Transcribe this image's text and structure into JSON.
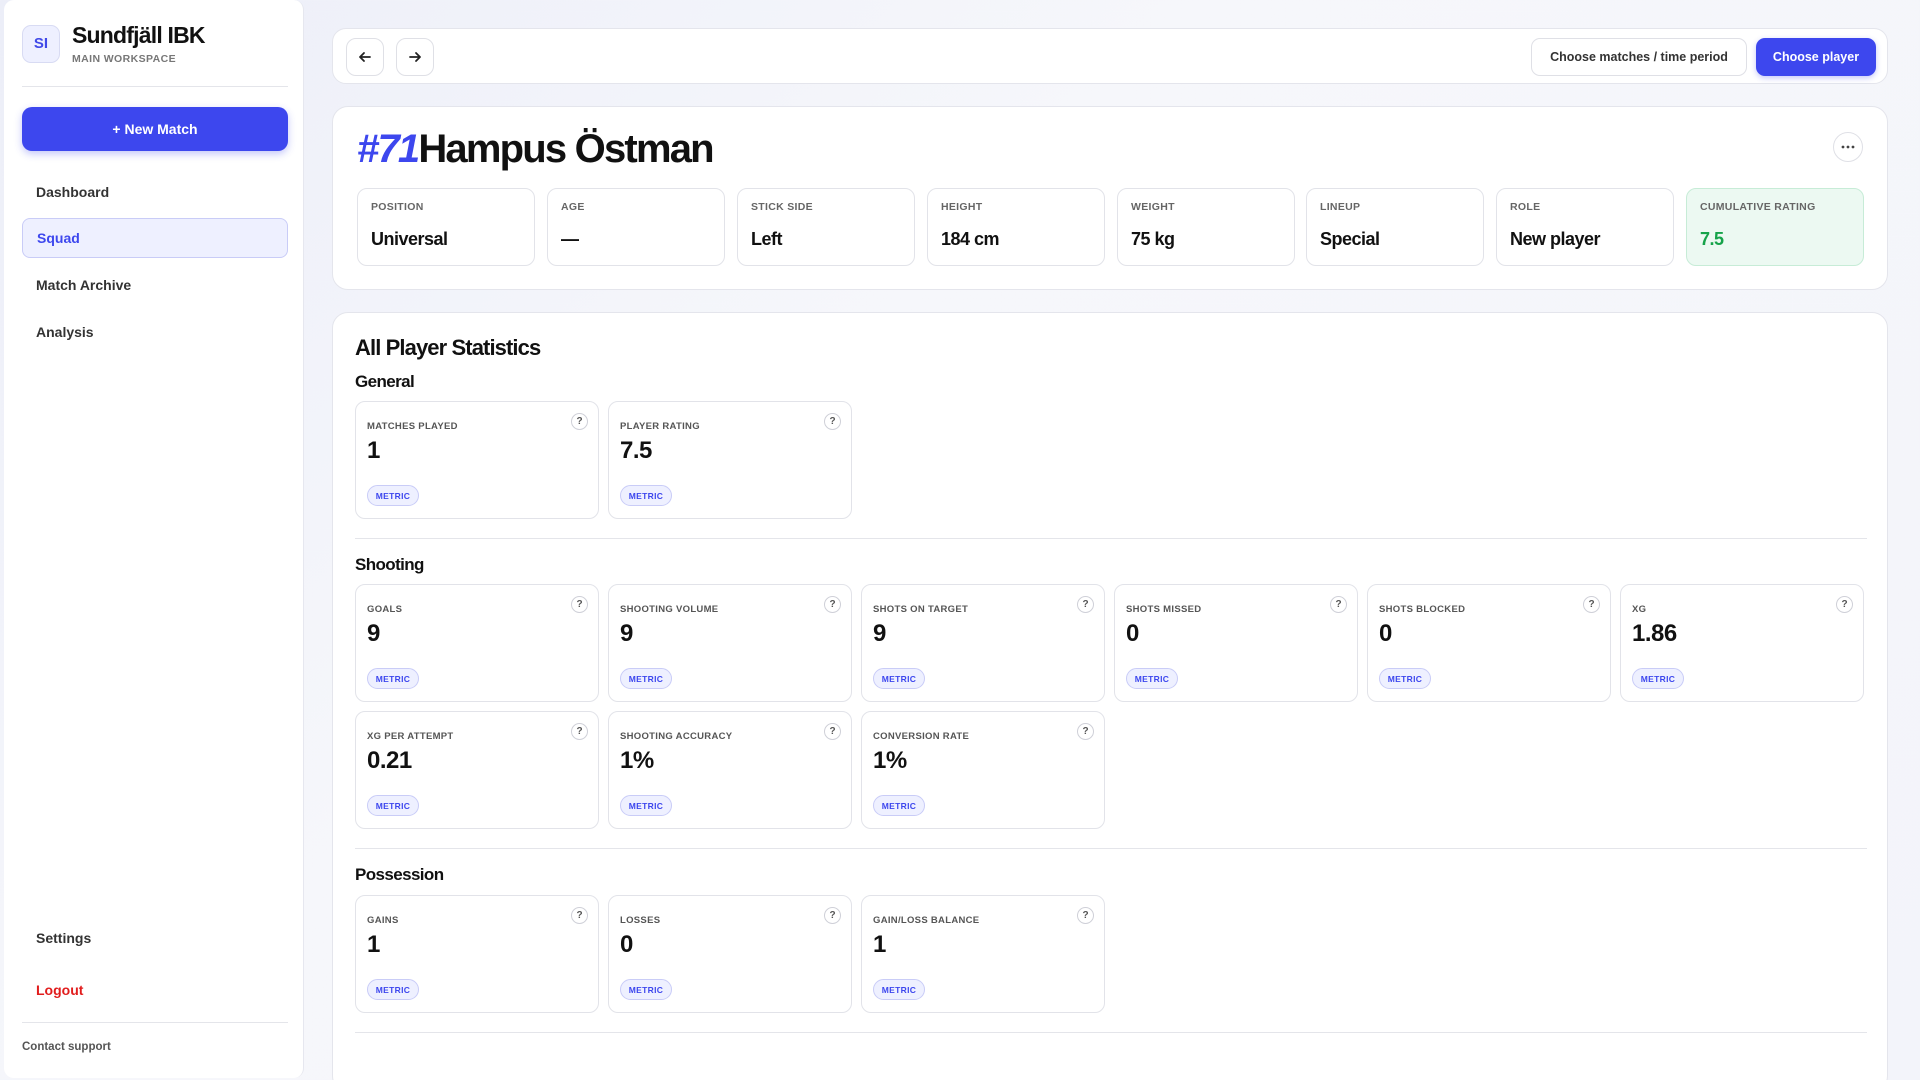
{
  "sidebar": {
    "logo": "SI",
    "team_name": "Sundfjäll IBK",
    "workspace": "MAIN WORKSPACE",
    "new_match": "+ New Match",
    "nav": [
      "Dashboard",
      "Squad",
      "Match Archive",
      "Analysis"
    ],
    "active_nav": "Squad",
    "settings": "Settings",
    "logout": "Logout",
    "contact": "Contact support"
  },
  "topbar": {
    "back_icon": "arrow-left-icon",
    "forward_icon": "arrow-right-icon",
    "choose_period": "Choose matches / time period",
    "choose_player": "Choose player"
  },
  "player": {
    "number": "#71",
    "name": "Hampus Östman",
    "more_icon": "more-horizontal-icon",
    "attributes": [
      {
        "label": "POSITION",
        "value": "Universal"
      },
      {
        "label": "AGE",
        "value": "—"
      },
      {
        "label": "STICK SIDE",
        "value": "Left"
      },
      {
        "label": "HEIGHT",
        "value": "184 cm"
      },
      {
        "label": "WEIGHT",
        "value": "75 kg"
      },
      {
        "label": "LINEUP",
        "value": "Special"
      },
      {
        "label": "ROLE",
        "value": "New player"
      },
      {
        "label": "CUMULATIVE RATING",
        "value": "7.5"
      }
    ]
  },
  "stats": {
    "title": "All Player Statistics",
    "badge": "METRIC",
    "help": "?",
    "sections": [
      {
        "title": "General",
        "items": [
          {
            "label": "MATCHES PLAYED",
            "value": "1"
          },
          {
            "label": "PLAYER RATING",
            "value": "7.5"
          }
        ]
      },
      {
        "title": "Shooting",
        "items": [
          {
            "label": "GOALS",
            "value": "9"
          },
          {
            "label": "SHOOTING VOLUME",
            "value": "9"
          },
          {
            "label": "SHOTS ON TARGET",
            "value": "9"
          },
          {
            "label": "SHOTS MISSED",
            "value": "0"
          },
          {
            "label": "SHOTS BLOCKED",
            "value": "0"
          },
          {
            "label": "XG",
            "value": "1.86"
          },
          {
            "label": "XG PER ATTEMPT",
            "value": "0.21"
          },
          {
            "label": "SHOOTING ACCURACY",
            "value": "1%"
          },
          {
            "label": "CONVERSION RATE",
            "value": "1%"
          }
        ]
      },
      {
        "title": "Possession",
        "items": [
          {
            "label": "GAINS",
            "value": "1"
          },
          {
            "label": "LOSSES",
            "value": "0"
          },
          {
            "label": "GAIN/LOSS BALANCE",
            "value": "1"
          }
        ]
      }
    ]
  }
}
